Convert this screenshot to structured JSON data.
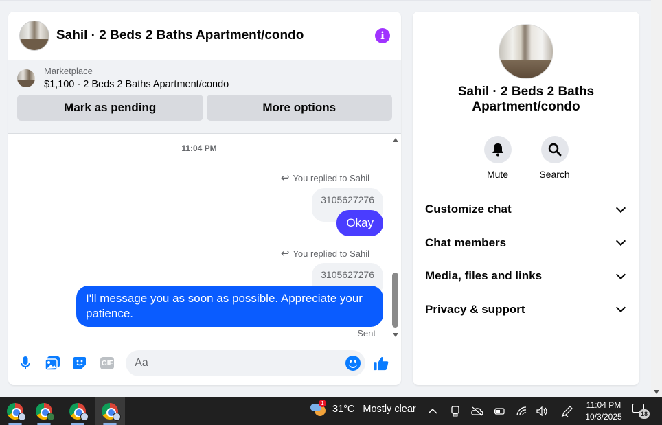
{
  "chat": {
    "title": "Sahil · 2 Beds 2 Baths Apartment/condo",
    "marketplace": {
      "label": "Marketplace",
      "listing": "$1,100 - 2 Beds 2 Baths Apartment/condo",
      "mark_pending": "Mark as pending",
      "more_options": "More options"
    },
    "messages": {
      "timestamp": "11:04 PM",
      "reply1_label": "You replied to Sahil",
      "reply1_quote": "3105627276",
      "reply1_text": "Okay",
      "reply2_label": "You replied to Sahil",
      "reply2_quote": "3105627276",
      "reply2_text": "I'll message you as soon as possible. Appreciate your patience.",
      "status": "Sent"
    },
    "composer": {
      "placeholder": "Aa",
      "gif_label": "GIF"
    },
    "colors": {
      "accent": "#0a5cff",
      "info_purple": "#a033ff"
    }
  },
  "info_panel": {
    "title": "Sahil · 2 Beds 2 Baths Apartment/condo",
    "actions": [
      {
        "label": "Mute",
        "icon": "bell-icon"
      },
      {
        "label": "Search",
        "icon": "search-icon"
      }
    ],
    "sections": [
      "Customize chat",
      "Chat members",
      "Media, files and links",
      "Privacy & support"
    ]
  },
  "taskbar": {
    "weather": {
      "temp": "31°C",
      "condition": "Mostly clear",
      "alert_count": "1"
    },
    "clock": {
      "time": "11:04 PM",
      "date": "10/3/2025"
    },
    "notification_count": "18"
  }
}
